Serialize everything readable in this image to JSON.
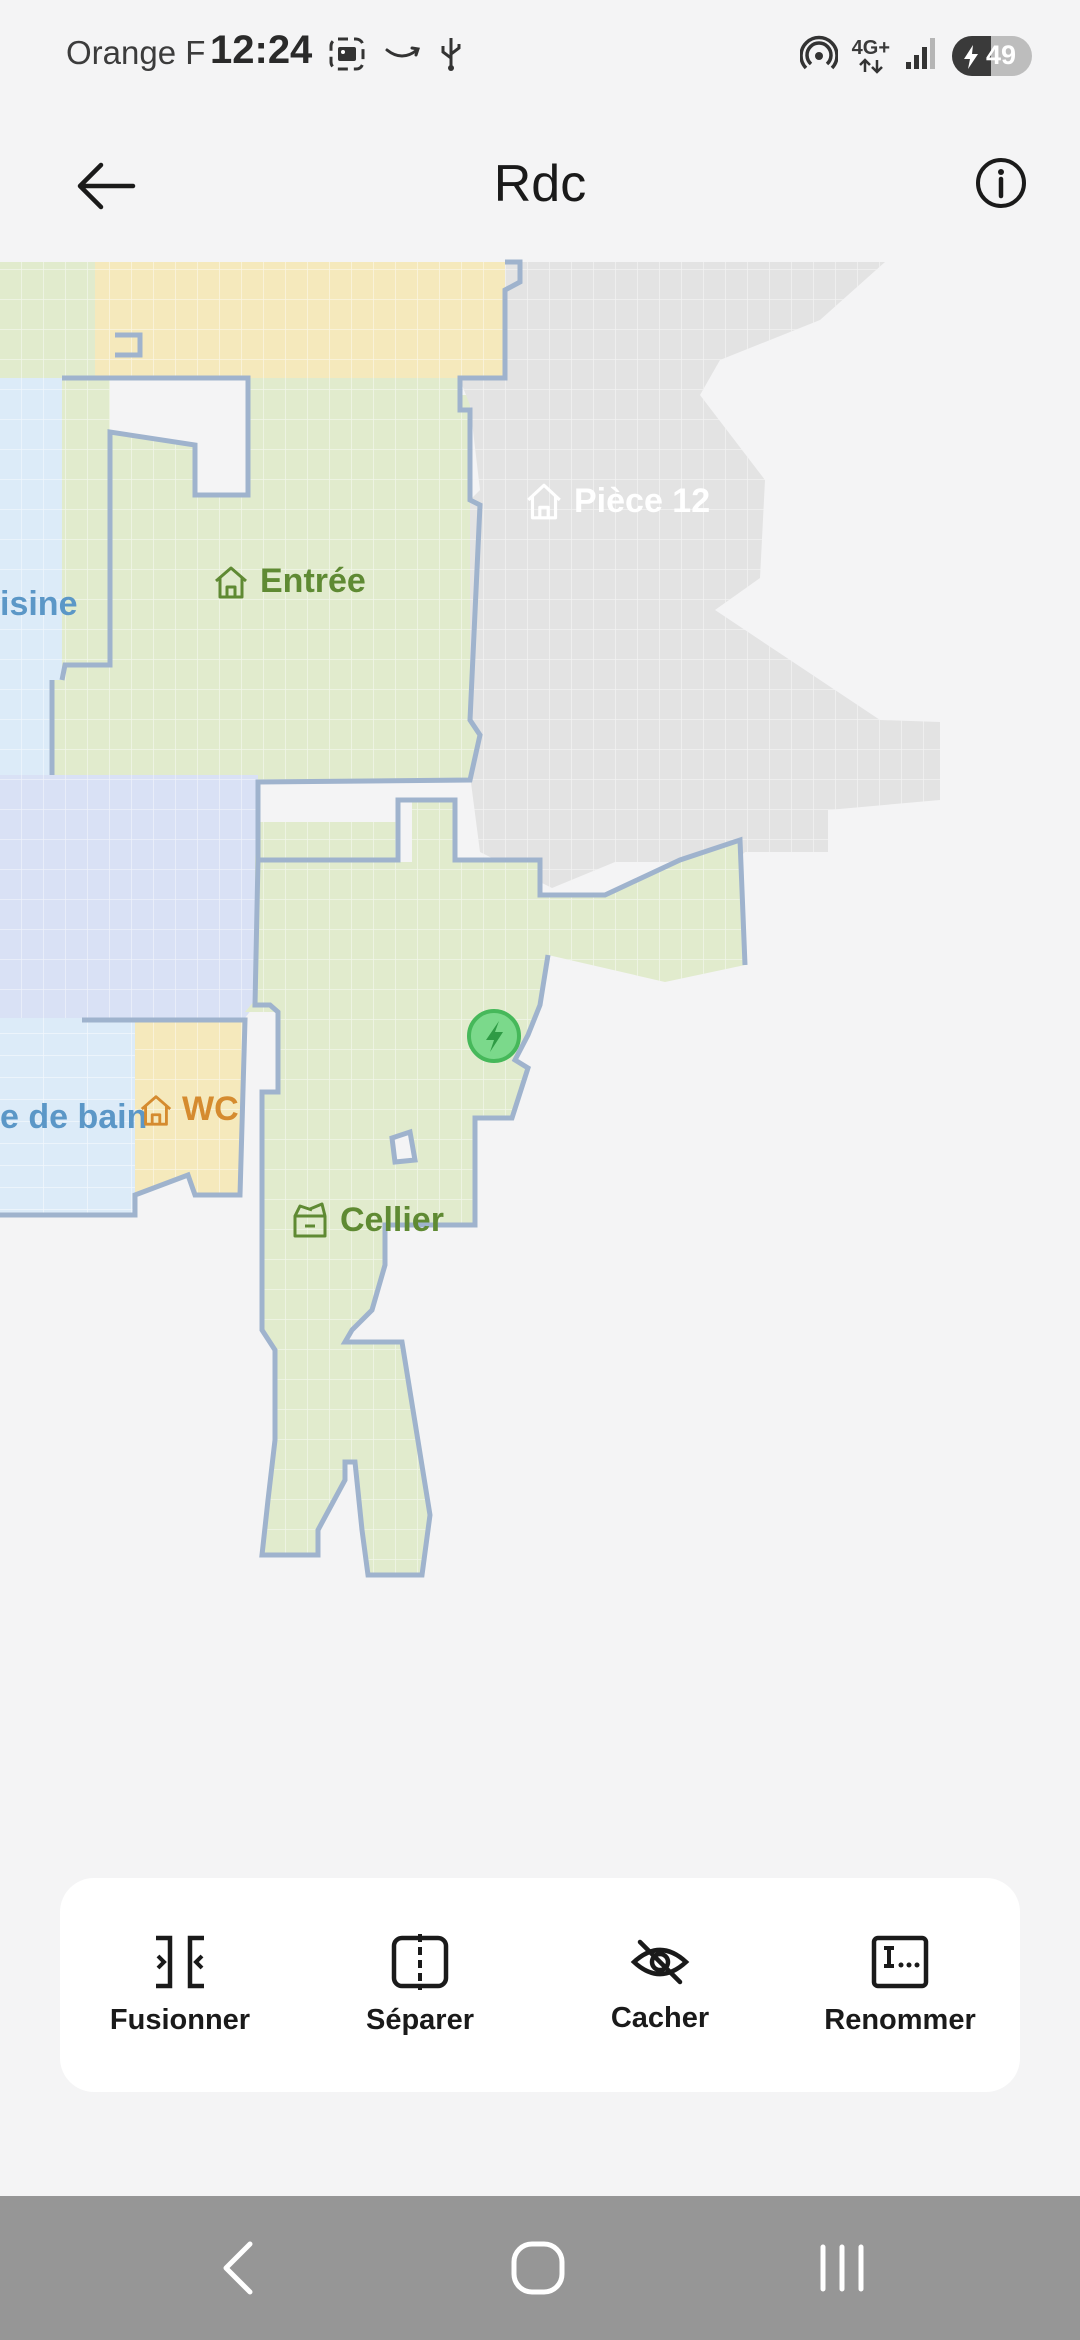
{
  "status_bar": {
    "carrier": "Orange F",
    "time": "12:24",
    "network": "4G+",
    "battery_level": "49",
    "battery_fraction": 0.49
  },
  "app_bar": {
    "title": "Rdc",
    "back_icon": "arrow-left-icon",
    "info_icon": "info-icon"
  },
  "map": {
    "rooms": [
      {
        "name": "isine",
        "color": "#5b97c7",
        "icon": ""
      },
      {
        "name": "Entrée",
        "color": "#5f8a33",
        "icon": "home-icon"
      },
      {
        "name": "Pièce 12",
        "color": "#ffffff",
        "icon": "home-icon"
      },
      {
        "name": "e de bain",
        "color": "#5b97c7",
        "icon": ""
      },
      {
        "name": "WC",
        "color": "#d58b2f",
        "icon": "home-icon"
      },
      {
        "name": "Cellier",
        "color": "#5f8a33",
        "icon": "storage-box-icon"
      }
    ],
    "dock_icon": "charging-dock-icon",
    "colors": {
      "green": "#e1ebcd",
      "yellow": "#f5e9bc",
      "light_blue": "#dcebf8",
      "lavender": "#d9e1f5",
      "gray": "#e3e3e3",
      "outline": "#9fb3cd"
    }
  },
  "actions": [
    {
      "label": "Fusionner",
      "icon": "merge-icon"
    },
    {
      "label": "Séparer",
      "icon": "split-icon"
    },
    {
      "label": "Cacher",
      "icon": "eye-off-icon"
    },
    {
      "label": "Renommer",
      "icon": "rename-icon"
    }
  ],
  "nav_bar": {
    "back": "nav-back-icon",
    "home": "nav-home-icon",
    "recents": "nav-recents-icon"
  }
}
